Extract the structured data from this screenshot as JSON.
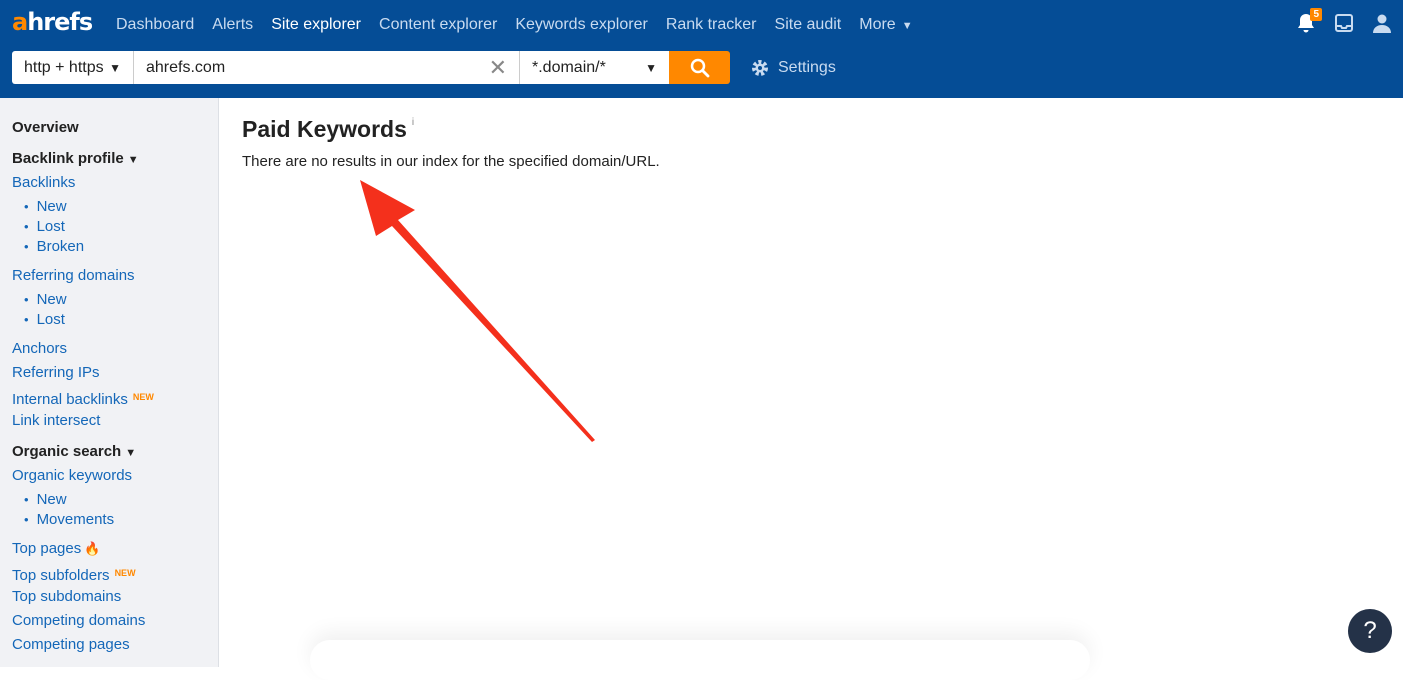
{
  "brand": {
    "logo_a": "a",
    "logo_rest": "hrefs"
  },
  "nav": {
    "items": [
      {
        "label": "Dashboard"
      },
      {
        "label": "Alerts"
      },
      {
        "label": "Site explorer"
      },
      {
        "label": "Content explorer"
      },
      {
        "label": "Keywords explorer"
      },
      {
        "label": "Rank tracker"
      },
      {
        "label": "Site audit"
      },
      {
        "label": "More"
      }
    ],
    "active": "Site explorer",
    "notifications_count": "5"
  },
  "search": {
    "protocol": "http + https",
    "url_value": "ahrefs.com",
    "mode": "*.domain/*",
    "settings_label": "Settings"
  },
  "sidebar": {
    "overview": "Overview",
    "backlink_profile": "Backlink profile",
    "backlinks": "Backlinks",
    "backlinks_new": "New",
    "backlinks_lost": "Lost",
    "backlinks_broken": "Broken",
    "referring_domains": "Referring domains",
    "rd_new": "New",
    "rd_lost": "Lost",
    "anchors": "Anchors",
    "referring_ips": "Referring IPs",
    "internal_backlinks": "Internal backlinks",
    "new_tag": "NEW",
    "link_intersect": "Link intersect",
    "organic_search": "Organic search",
    "organic_keywords": "Organic keywords",
    "ok_new": "New",
    "ok_movements": "Movements",
    "top_pages": "Top pages",
    "top_subfolders": "Top subfolders",
    "top_subdomains": "Top subdomains",
    "competing_domains": "Competing domains",
    "competing_pages": "Competing pages"
  },
  "main": {
    "title": "Paid Keywords",
    "info": "i",
    "message": "There are no results in our index for the specified domain/URL."
  },
  "help": {
    "label": "?"
  },
  "colors": {
    "topbar": "#054d96",
    "accent": "#ff8800",
    "link": "#1467b8",
    "arrow": "#f4301c"
  }
}
